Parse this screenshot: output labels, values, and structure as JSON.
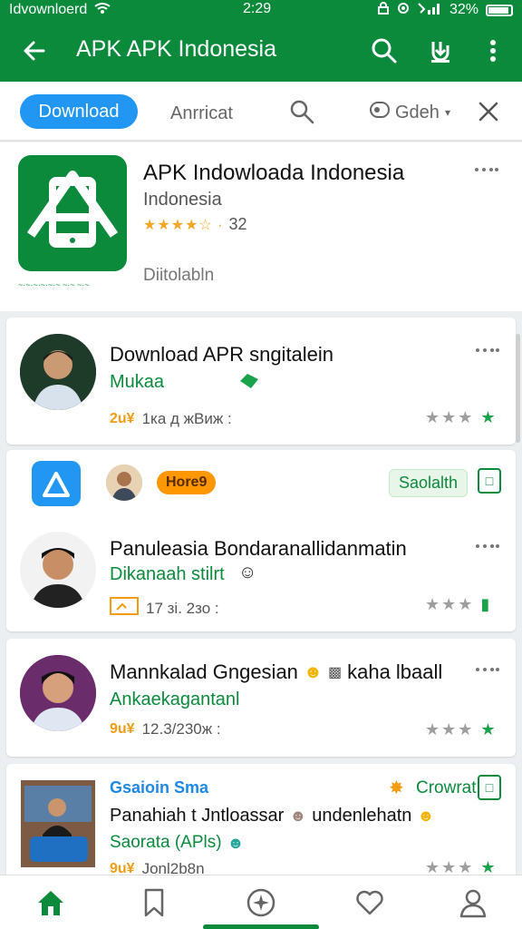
{
  "status_bar": {
    "left_text": "Idvownloerd",
    "time": "2:29",
    "battery": "32%"
  },
  "app_bar": {
    "title": "APK APK Indonesia"
  },
  "filters": {
    "active_pill": "Download",
    "category": "Anrricat",
    "sort_label": "Gdeh"
  },
  "header_app": {
    "title": "APK Indowloada Indonesia",
    "subtitle": "Indonesia",
    "rating": "32",
    "status": "Diitolabln",
    "icon_caption": "~·~·~·~·~·~ ~·~ ~·~"
  },
  "items": [
    {
      "title": "Download APR sngitalein",
      "subtitle": "Mukaa",
      "meta": "1ка д жВиж :",
      "meta_code": "2u¥"
    },
    {
      "title": "Panuleasia Bondaranallidanmatin",
      "subtitle": "Dikanaah stilrt",
      "meta": "17 зі. 2зо :",
      "badge": "Hore9",
      "badge_right": "Saolalth"
    },
    {
      "title": "Mannkalad Gngesian",
      "title_suffix": "kaha lbaall",
      "subtitle": "Ankaekagantanl",
      "meta": "12.3/230ж :",
      "meta_code": "9u¥"
    },
    {
      "title": "Panahiah t Jntloassar",
      "title_suffix": "undenlehatn",
      "subtitle": "Saorata (APls)",
      "meta": "Jonl2b8n",
      "meta_code": "9u¥",
      "headline": "Gsaioin Sma",
      "badge_right": "Crowrat"
    }
  ],
  "colors": {
    "brand_green": "#0b8a3c",
    "pill_blue": "#2196f3",
    "star_orange": "#f5a623"
  }
}
